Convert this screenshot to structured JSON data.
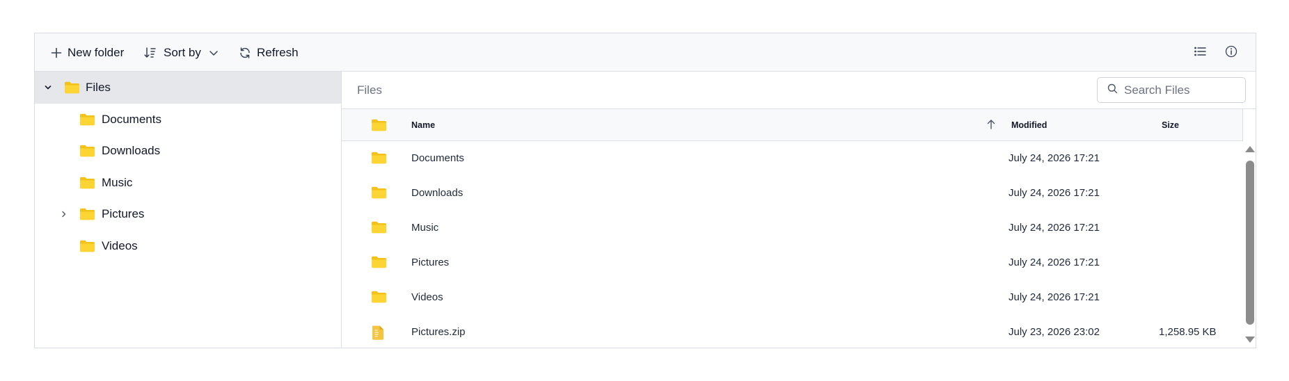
{
  "toolbar": {
    "new_folder_label": "New folder",
    "sort_by_label": "Sort by",
    "refresh_label": "Refresh",
    "view_icon": "list-view-icon",
    "details_icon": "info-icon"
  },
  "navigation": {
    "root": {
      "label": "Files",
      "expanded": true
    },
    "items": [
      {
        "label": "Documents",
        "has_children": false
      },
      {
        "label": "Downloads",
        "has_children": false
      },
      {
        "label": "Music",
        "has_children": false
      },
      {
        "label": "Pictures",
        "has_children": true
      },
      {
        "label": "Videos",
        "has_children": false
      }
    ]
  },
  "address_bar": {
    "breadcrumb": "Files",
    "search_placeholder": "Search Files"
  },
  "grid": {
    "columns": {
      "name": "Name",
      "modified": "Modified",
      "size": "Size"
    },
    "sort": {
      "column": "Name",
      "direction": "ascending"
    },
    "rows": [
      {
        "type": "folder",
        "name": "Documents",
        "modified": "July 24, 2026 17:21",
        "size": ""
      },
      {
        "type": "folder",
        "name": "Downloads",
        "modified": "July 24, 2026 17:21",
        "size": ""
      },
      {
        "type": "folder",
        "name": "Music",
        "modified": "July 24, 2026 17:21",
        "size": ""
      },
      {
        "type": "folder",
        "name": "Pictures",
        "modified": "July 24, 2026 17:21",
        "size": ""
      },
      {
        "type": "folder",
        "name": "Videos",
        "modified": "July 24, 2026 17:21",
        "size": ""
      },
      {
        "type": "zip",
        "name": "Pictures.zip",
        "modified": "July 23, 2026 23:02",
        "size": "1,258.95 KB"
      }
    ]
  },
  "colors": {
    "folder": "#FCD535",
    "folder_dark": "#F2C21A",
    "selected_row": "#E5E7EB",
    "toolbar_bg": "#F8F9FB",
    "border": "#DCDFE4"
  }
}
